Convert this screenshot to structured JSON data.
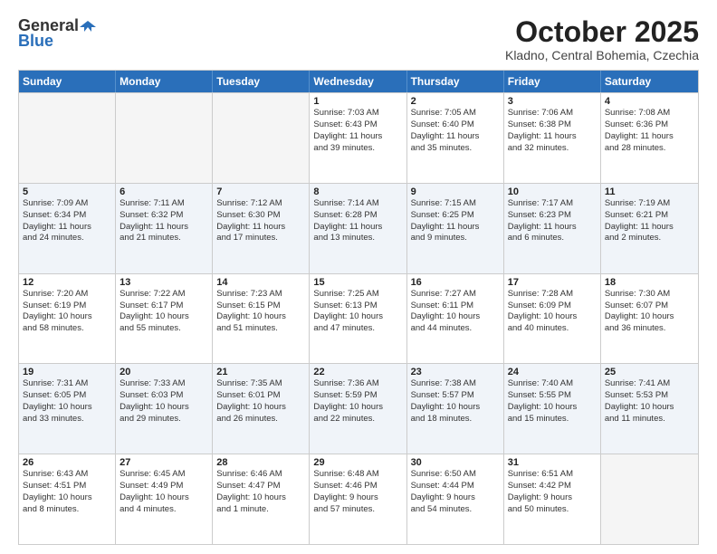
{
  "header": {
    "logo_general": "General",
    "logo_blue": "Blue",
    "month": "October 2025",
    "location": "Kladno, Central Bohemia, Czechia"
  },
  "weekdays": [
    "Sunday",
    "Monday",
    "Tuesday",
    "Wednesday",
    "Thursday",
    "Friday",
    "Saturday"
  ],
  "rows": [
    {
      "alt": false,
      "cells": [
        {
          "day": "",
          "info": ""
        },
        {
          "day": "",
          "info": ""
        },
        {
          "day": "",
          "info": ""
        },
        {
          "day": "1",
          "info": "Sunrise: 7:03 AM\nSunset: 6:43 PM\nDaylight: 11 hours\nand 39 minutes."
        },
        {
          "day": "2",
          "info": "Sunrise: 7:05 AM\nSunset: 6:40 PM\nDaylight: 11 hours\nand 35 minutes."
        },
        {
          "day": "3",
          "info": "Sunrise: 7:06 AM\nSunset: 6:38 PM\nDaylight: 11 hours\nand 32 minutes."
        },
        {
          "day": "4",
          "info": "Sunrise: 7:08 AM\nSunset: 6:36 PM\nDaylight: 11 hours\nand 28 minutes."
        }
      ]
    },
    {
      "alt": true,
      "cells": [
        {
          "day": "5",
          "info": "Sunrise: 7:09 AM\nSunset: 6:34 PM\nDaylight: 11 hours\nand 24 minutes."
        },
        {
          "day": "6",
          "info": "Sunrise: 7:11 AM\nSunset: 6:32 PM\nDaylight: 11 hours\nand 21 minutes."
        },
        {
          "day": "7",
          "info": "Sunrise: 7:12 AM\nSunset: 6:30 PM\nDaylight: 11 hours\nand 17 minutes."
        },
        {
          "day": "8",
          "info": "Sunrise: 7:14 AM\nSunset: 6:28 PM\nDaylight: 11 hours\nand 13 minutes."
        },
        {
          "day": "9",
          "info": "Sunrise: 7:15 AM\nSunset: 6:25 PM\nDaylight: 11 hours\nand 9 minutes."
        },
        {
          "day": "10",
          "info": "Sunrise: 7:17 AM\nSunset: 6:23 PM\nDaylight: 11 hours\nand 6 minutes."
        },
        {
          "day": "11",
          "info": "Sunrise: 7:19 AM\nSunset: 6:21 PM\nDaylight: 11 hours\nand 2 minutes."
        }
      ]
    },
    {
      "alt": false,
      "cells": [
        {
          "day": "12",
          "info": "Sunrise: 7:20 AM\nSunset: 6:19 PM\nDaylight: 10 hours\nand 58 minutes."
        },
        {
          "day": "13",
          "info": "Sunrise: 7:22 AM\nSunset: 6:17 PM\nDaylight: 10 hours\nand 55 minutes."
        },
        {
          "day": "14",
          "info": "Sunrise: 7:23 AM\nSunset: 6:15 PM\nDaylight: 10 hours\nand 51 minutes."
        },
        {
          "day": "15",
          "info": "Sunrise: 7:25 AM\nSunset: 6:13 PM\nDaylight: 10 hours\nand 47 minutes."
        },
        {
          "day": "16",
          "info": "Sunrise: 7:27 AM\nSunset: 6:11 PM\nDaylight: 10 hours\nand 44 minutes."
        },
        {
          "day": "17",
          "info": "Sunrise: 7:28 AM\nSunset: 6:09 PM\nDaylight: 10 hours\nand 40 minutes."
        },
        {
          "day": "18",
          "info": "Sunrise: 7:30 AM\nSunset: 6:07 PM\nDaylight: 10 hours\nand 36 minutes."
        }
      ]
    },
    {
      "alt": true,
      "cells": [
        {
          "day": "19",
          "info": "Sunrise: 7:31 AM\nSunset: 6:05 PM\nDaylight: 10 hours\nand 33 minutes."
        },
        {
          "day": "20",
          "info": "Sunrise: 7:33 AM\nSunset: 6:03 PM\nDaylight: 10 hours\nand 29 minutes."
        },
        {
          "day": "21",
          "info": "Sunrise: 7:35 AM\nSunset: 6:01 PM\nDaylight: 10 hours\nand 26 minutes."
        },
        {
          "day": "22",
          "info": "Sunrise: 7:36 AM\nSunset: 5:59 PM\nDaylight: 10 hours\nand 22 minutes."
        },
        {
          "day": "23",
          "info": "Sunrise: 7:38 AM\nSunset: 5:57 PM\nDaylight: 10 hours\nand 18 minutes."
        },
        {
          "day": "24",
          "info": "Sunrise: 7:40 AM\nSunset: 5:55 PM\nDaylight: 10 hours\nand 15 minutes."
        },
        {
          "day": "25",
          "info": "Sunrise: 7:41 AM\nSunset: 5:53 PM\nDaylight: 10 hours\nand 11 minutes."
        }
      ]
    },
    {
      "alt": false,
      "cells": [
        {
          "day": "26",
          "info": "Sunrise: 6:43 AM\nSunset: 4:51 PM\nDaylight: 10 hours\nand 8 minutes."
        },
        {
          "day": "27",
          "info": "Sunrise: 6:45 AM\nSunset: 4:49 PM\nDaylight: 10 hours\nand 4 minutes."
        },
        {
          "day": "28",
          "info": "Sunrise: 6:46 AM\nSunset: 4:47 PM\nDaylight: 10 hours\nand 1 minute."
        },
        {
          "day": "29",
          "info": "Sunrise: 6:48 AM\nSunset: 4:46 PM\nDaylight: 9 hours\nand 57 minutes."
        },
        {
          "day": "30",
          "info": "Sunrise: 6:50 AM\nSunset: 4:44 PM\nDaylight: 9 hours\nand 54 minutes."
        },
        {
          "day": "31",
          "info": "Sunrise: 6:51 AM\nSunset: 4:42 PM\nDaylight: 9 hours\nand 50 minutes."
        },
        {
          "day": "",
          "info": ""
        }
      ]
    }
  ]
}
